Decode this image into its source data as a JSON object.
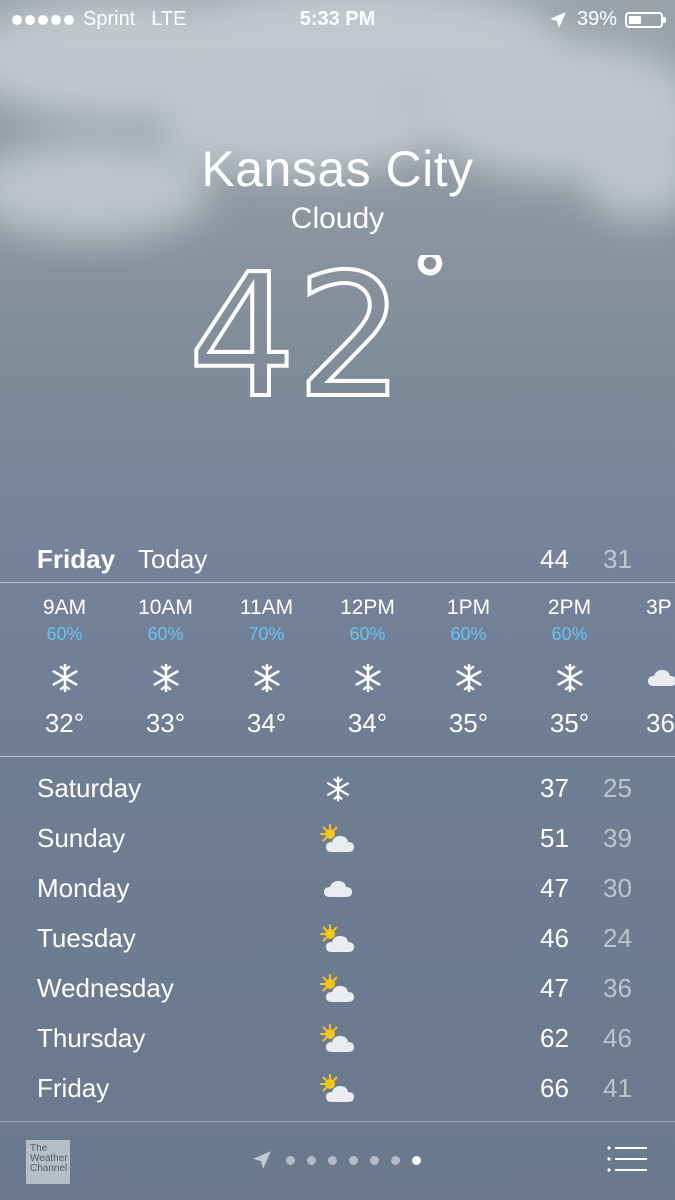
{
  "status": {
    "carrier": "Sprint",
    "network": "LTE",
    "time": "5:33 PM",
    "battery": "39%",
    "battery_level": 0.39
  },
  "location": {
    "city": "Kansas City",
    "condition": "Cloudy",
    "temp": "42",
    "degree": "°"
  },
  "today": {
    "day": "Friday",
    "label": "Today",
    "hi": "44",
    "lo": "31"
  },
  "hourly": [
    {
      "time": "9AM",
      "precip": "60%",
      "icon": "snowflake-icon",
      "temp": "32°"
    },
    {
      "time": "10AM",
      "precip": "60%",
      "icon": "snowflake-icon",
      "temp": "33°"
    },
    {
      "time": "11AM",
      "precip": "70%",
      "icon": "snowflake-icon",
      "temp": "34°"
    },
    {
      "time": "12PM",
      "precip": "60%",
      "icon": "snowflake-icon",
      "temp": "34°"
    },
    {
      "time": "1PM",
      "precip": "60%",
      "icon": "snowflake-icon",
      "temp": "35°"
    },
    {
      "time": "2PM",
      "precip": "60%",
      "icon": "snowflake-icon",
      "temp": "35°"
    },
    {
      "time": "3P",
      "precip": "",
      "icon": "cloud-icon",
      "temp": "36"
    }
  ],
  "daily": [
    {
      "day": "Saturday",
      "icon": "snowflake-icon",
      "hi": "37",
      "lo": "25"
    },
    {
      "day": "Sunday",
      "icon": "partly-sunny-icon",
      "hi": "51",
      "lo": "39"
    },
    {
      "day": "Monday",
      "icon": "cloud-icon",
      "hi": "47",
      "lo": "30"
    },
    {
      "day": "Tuesday",
      "icon": "partly-sunny-icon",
      "hi": "46",
      "lo": "24"
    },
    {
      "day": "Wednesday",
      "icon": "partly-sunny-icon",
      "hi": "47",
      "lo": "36"
    },
    {
      "day": "Thursday",
      "icon": "partly-sunny-icon",
      "hi": "62",
      "lo": "46"
    },
    {
      "day": "Friday",
      "icon": "partly-sunny-icon",
      "hi": "66",
      "lo": "41"
    }
  ],
  "footer": {
    "logo_text": [
      "The",
      "Weather",
      "Channel"
    ],
    "page_count": 7,
    "active_page": 6
  },
  "colors": {
    "precip": "#6cc3f0",
    "sun": "#f5c518",
    "cloud": "#e9edf1"
  }
}
